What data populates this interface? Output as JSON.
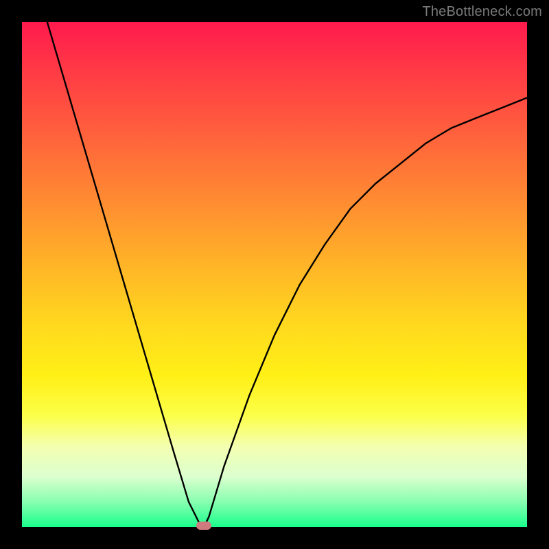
{
  "watermark": "TheBottleneck.com",
  "chart_data": {
    "type": "line",
    "title": "",
    "xlabel": "",
    "ylabel": "",
    "xlim": [
      0,
      100
    ],
    "ylim": [
      0,
      100
    ],
    "grid": false,
    "legend": false,
    "colors": {
      "background_top": "#ff1a4d",
      "background_bottom": "#19ff8c",
      "curve": "#000000",
      "marker": "#cf7a7e"
    },
    "series": [
      {
        "name": "bottleneck-curve",
        "x": [
          5,
          10,
          15,
          20,
          25,
          30,
          33,
          35,
          36,
          37,
          40,
          45,
          50,
          55,
          60,
          65,
          70,
          75,
          80,
          85,
          90,
          95,
          100
        ],
        "y": [
          100,
          83,
          66,
          49,
          32,
          15,
          5,
          1,
          0,
          2,
          12,
          26,
          38,
          48,
          56,
          63,
          68,
          72,
          76,
          79,
          81,
          83,
          85
        ]
      }
    ],
    "annotations": [
      {
        "name": "min-marker",
        "x": 36,
        "y": 0
      }
    ]
  }
}
